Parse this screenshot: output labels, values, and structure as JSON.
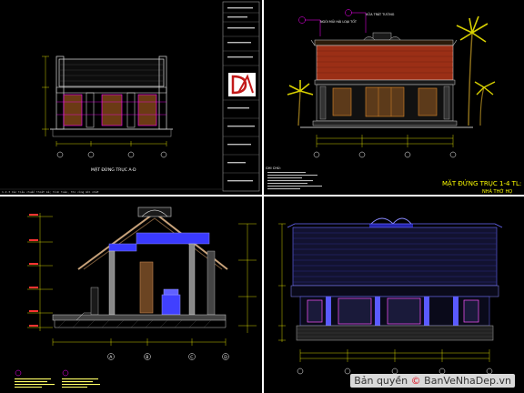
{
  "panel1": {
    "caption": "MẶT ĐỨNG TRỤC A-D",
    "status_line": "1.2.3 Các tiêu chuẩn thiết kế, tính toán, thi công mới nhất"
  },
  "panel2": {
    "title": "MẶT ĐỨNG TRỤC 1-4 TL: 1/40",
    "subtitle": "NHÀ THỜ HỌ",
    "note_header": "GHI CHÚ:",
    "roof_label": "NGÓI MŨI HÀI LOẠI TỐT",
    "roof_label2": "VỮA TRÁT TƯỜNG"
  },
  "panel3": {
    "axis_labels": [
      "A",
      "B",
      "C",
      "D"
    ]
  },
  "panel4": {},
  "watermark": {
    "prefix": "Bản quyền ",
    "copyright_symbol": "©",
    "site": " BanVeNhaDep.vn"
  },
  "colors": {
    "background": "#000000",
    "cad_yellow": "#ffff00",
    "cad_magenta": "#ff00ff",
    "roof_red": "#9b2f16",
    "cad_blue": "#3a3aff"
  }
}
